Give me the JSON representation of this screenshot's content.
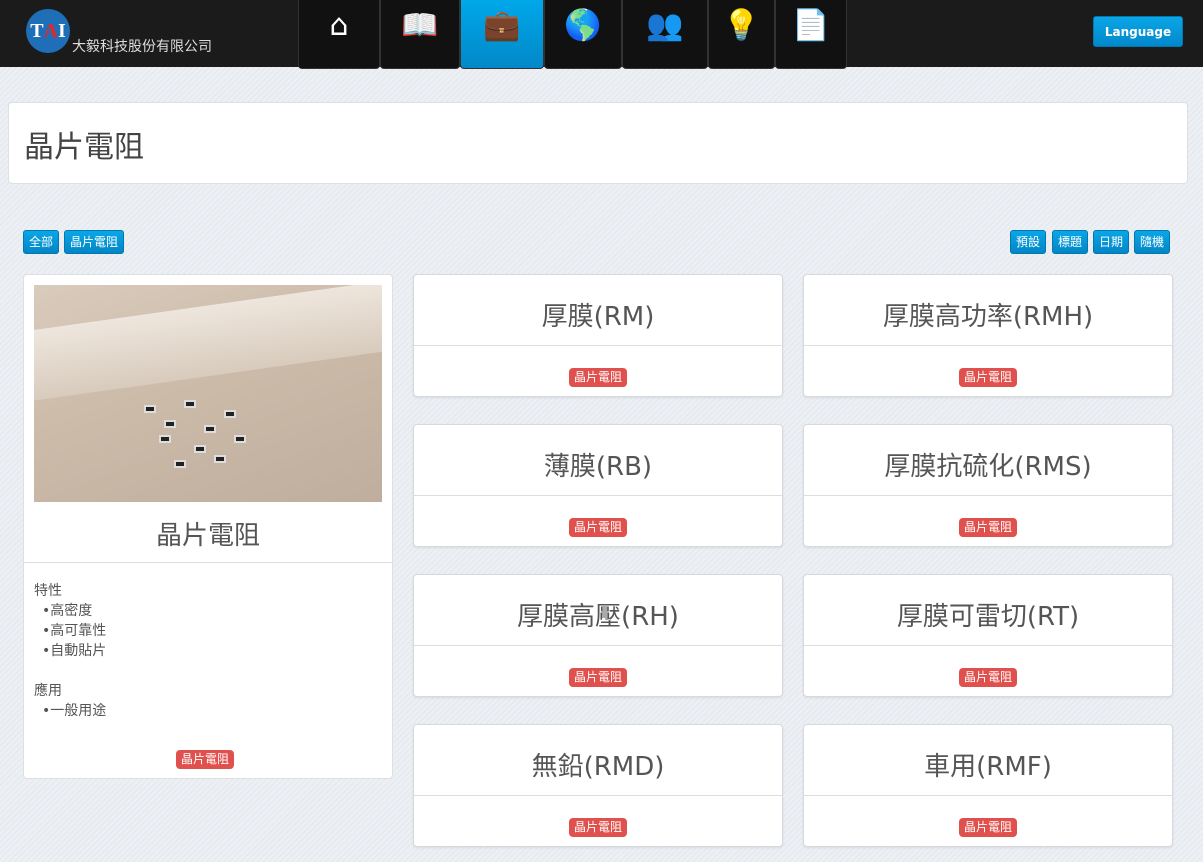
{
  "header": {
    "logo_text": "TAI",
    "company": "大毅科技股份有限公司",
    "language": "Language",
    "nav": [
      {
        "icon": "home-icon"
      },
      {
        "icon": "book-icon"
      },
      {
        "icon": "briefcase-icon"
      },
      {
        "icon": "globe-icon"
      },
      {
        "icon": "users-icon"
      },
      {
        "icon": "lightbulb-icon"
      },
      {
        "icon": "document-icon"
      }
    ]
  },
  "page_title": "晶片電阻",
  "filters": [
    "全部",
    "晶片電阻"
  ],
  "sort": [
    "預設",
    "標題",
    "日期",
    "隨機"
  ],
  "feature": {
    "title": "晶片電阻",
    "heading1": "特性",
    "items1": [
      "•高密度",
      "•高可靠性",
      "•自動貼片"
    ],
    "heading2": "應用",
    "items2": [
      "•一般用途"
    ],
    "tag": "晶片電阻"
  },
  "products": [
    {
      "title": "厚膜(RM)",
      "tag": "晶片電阻"
    },
    {
      "title": "厚膜高功率(RMH)",
      "tag": "晶片電阻"
    },
    {
      "title": "薄膜(RB)",
      "tag": "晶片電阻"
    },
    {
      "title": "厚膜抗硫化(RMS)",
      "tag": "晶片電阻"
    },
    {
      "title": "厚膜高壓(RH)",
      "tag": "晶片電阻"
    },
    {
      "title": "厚膜可雷切(RT)",
      "tag": "晶片電阻"
    },
    {
      "title": "無鉛(RMD)",
      "tag": "晶片電阻"
    },
    {
      "title": "車用(RMF)",
      "tag": "晶片電阻"
    }
  ]
}
